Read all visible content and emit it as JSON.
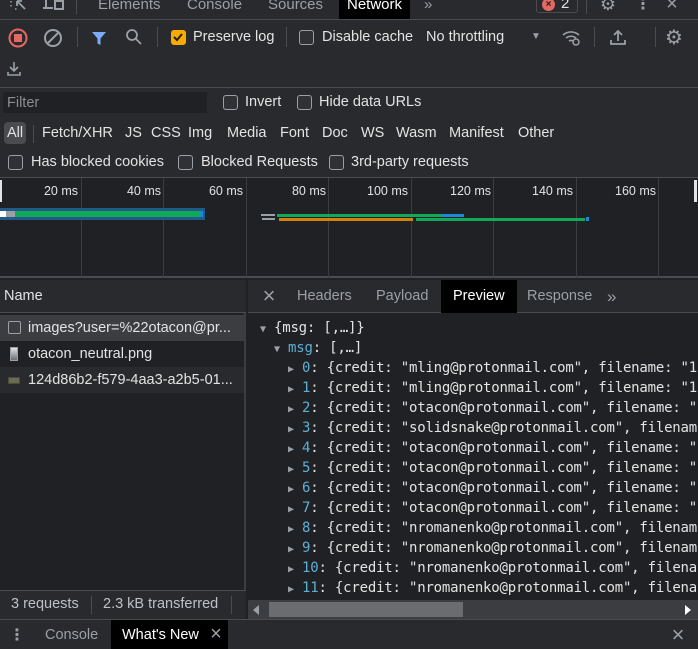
{
  "top_tabs": {
    "items": [
      {
        "label": "Elements",
        "active": false
      },
      {
        "label": "Console",
        "active": false
      },
      {
        "label": "Sources",
        "active": false
      },
      {
        "label": "Network",
        "active": true
      }
    ],
    "more_icon": "double-chevron-right-icon",
    "error_count": "2"
  },
  "toolbar": {
    "preserve_log_label": "Preserve log",
    "preserve_log_checked": true,
    "disable_cache_label": "Disable cache",
    "disable_cache_checked": false,
    "throttling_value": "No throttling"
  },
  "filter": {
    "placeholder": "Filter",
    "value": "",
    "invert_label": "Invert",
    "hide_data_urls_label": "Hide data URLs",
    "types": [
      "All",
      "Fetch/XHR",
      "JS",
      "CSS",
      "Img",
      "Media",
      "Font",
      "Doc",
      "WS",
      "Wasm",
      "Manifest",
      "Other"
    ],
    "active_type": "All",
    "has_blocked_cookies_label": "Has blocked cookies",
    "blocked_requests_label": "Blocked Requests",
    "third_party_label": "3rd-party requests"
  },
  "timeline": {
    "ticks": [
      "20 ms",
      "40 ms",
      "60 ms",
      "80 ms",
      "100 ms",
      "120 ms",
      "140 ms",
      "160 ms"
    ],
    "colors": {
      "waiting": "#0fa958",
      "download": "#1a8ad6",
      "queue": "#9aa0a6",
      "stalled": "#d6800a"
    }
  },
  "requests": {
    "header": "Name",
    "rows": [
      {
        "name": "images?user=%22otacon@pr...",
        "icon": "xhr-doc-icon",
        "selected": true
      },
      {
        "name": "otacon_neutral.png",
        "icon": "image-thumbnail-icon",
        "selected": false
      },
      {
        "name": "124d86b2-f579-4aa3-a2b5-01...",
        "icon": "image-thumbnail-icon",
        "selected": false
      }
    ],
    "status_requests": "3 requests",
    "status_transferred": "2.3 kB transferred"
  },
  "detail": {
    "tabs": [
      {
        "label": "Headers",
        "active": false
      },
      {
        "label": "Payload",
        "active": false
      },
      {
        "label": "Preview",
        "active": true
      },
      {
        "label": "Response",
        "active": false
      }
    ],
    "root_summary": "{msg: [,…]}",
    "msg_key": "msg",
    "msg_summary": "[,…]",
    "items": [
      {
        "index": "0",
        "credit": "mling@protonmail.com",
        "tail": ", filename: \"1"
      },
      {
        "index": "1",
        "credit": "mling@protonmail.com",
        "tail": ", filename: \"1"
      },
      {
        "index": "2",
        "credit": "otacon@protonmail.com",
        "tail": ", filename: \""
      },
      {
        "index": "3",
        "credit": "solidsnake@protonmail.com",
        "tail": ", filenam"
      },
      {
        "index": "4",
        "credit": "otacon@protonmail.com",
        "tail": ", filename: \""
      },
      {
        "index": "5",
        "credit": "otacon@protonmail.com",
        "tail": ", filename: \""
      },
      {
        "index": "6",
        "credit": "otacon@protonmail.com",
        "tail": ", filename: \""
      },
      {
        "index": "7",
        "credit": "otacon@protonmail.com",
        "tail": ", filename: \""
      },
      {
        "index": "8",
        "credit": "nromanenko@protonmail.com",
        "tail": ", filenam"
      },
      {
        "index": "9",
        "credit": "nromanenko@protonmail.com",
        "tail": ", filenam"
      },
      {
        "index": "10",
        "credit": "nromanenko@protonmail.com",
        "tail": ", filena"
      },
      {
        "index": "11",
        "credit": "nromanenko@protonmail.com",
        "tail": ", filena"
      }
    ]
  },
  "drawer": {
    "tabs": [
      {
        "label": "Console",
        "active": false
      },
      {
        "label": "What's New",
        "active": true
      }
    ]
  }
}
